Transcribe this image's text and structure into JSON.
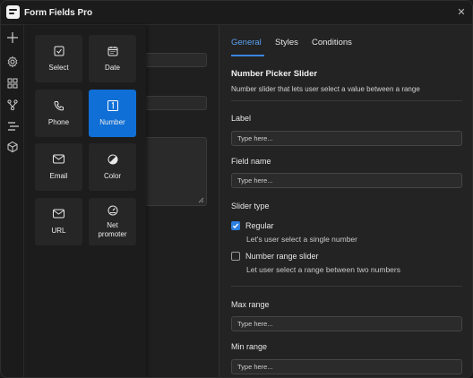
{
  "app": {
    "title": "Form Fields Pro",
    "logo_icon": "form-logo-icon",
    "close_icon": "close-icon"
  },
  "rail": {
    "icons": [
      "plus-icon",
      "gear-icon",
      "grid-icon",
      "flow-icon",
      "align-icon",
      "cube-icon"
    ]
  },
  "picker": {
    "tiles": [
      {
        "label": "Select",
        "icon": "checkbox-icon",
        "active": false
      },
      {
        "label": "Date",
        "icon": "calendar-icon",
        "active": false
      },
      {
        "label": "Phone",
        "icon": "phone-icon",
        "active": false
      },
      {
        "label": "Number",
        "icon": "number-icon",
        "active": true
      },
      {
        "label": "Email",
        "icon": "mail-icon",
        "active": false
      },
      {
        "label": "Color",
        "icon": "color-icon",
        "active": false
      },
      {
        "label": "URL",
        "icon": "mail-icon",
        "active": false
      },
      {
        "label": "Net\npromoter",
        "icon": "gauge-icon",
        "active": false
      }
    ]
  },
  "panel": {
    "tabs": [
      "General",
      "Styles",
      "Conditions"
    ],
    "active_tab": "General",
    "section_title": "Number Picker Slider",
    "section_desc": "Number slider that lets user select a value between a range",
    "label_field": {
      "label": "Label",
      "placeholder": "Type here..."
    },
    "name_field": {
      "label": "Field name",
      "placeholder": "Type here..."
    },
    "slider_type": {
      "label": "Slider type",
      "options": [
        {
          "label": "Regular",
          "desc": "Let's user select a single number",
          "checked": true
        },
        {
          "label": "Number range slider",
          "desc": "Let user select a range between two numbers",
          "checked": false
        }
      ]
    },
    "max_range": {
      "label": "Max range",
      "placeholder": "Type here..."
    },
    "min_range": {
      "label": "Min range",
      "placeholder": "Type here..."
    }
  },
  "colors": {
    "accent": "#0f6fd6",
    "tab_active": "#5aa2f0",
    "background": "#232323"
  }
}
